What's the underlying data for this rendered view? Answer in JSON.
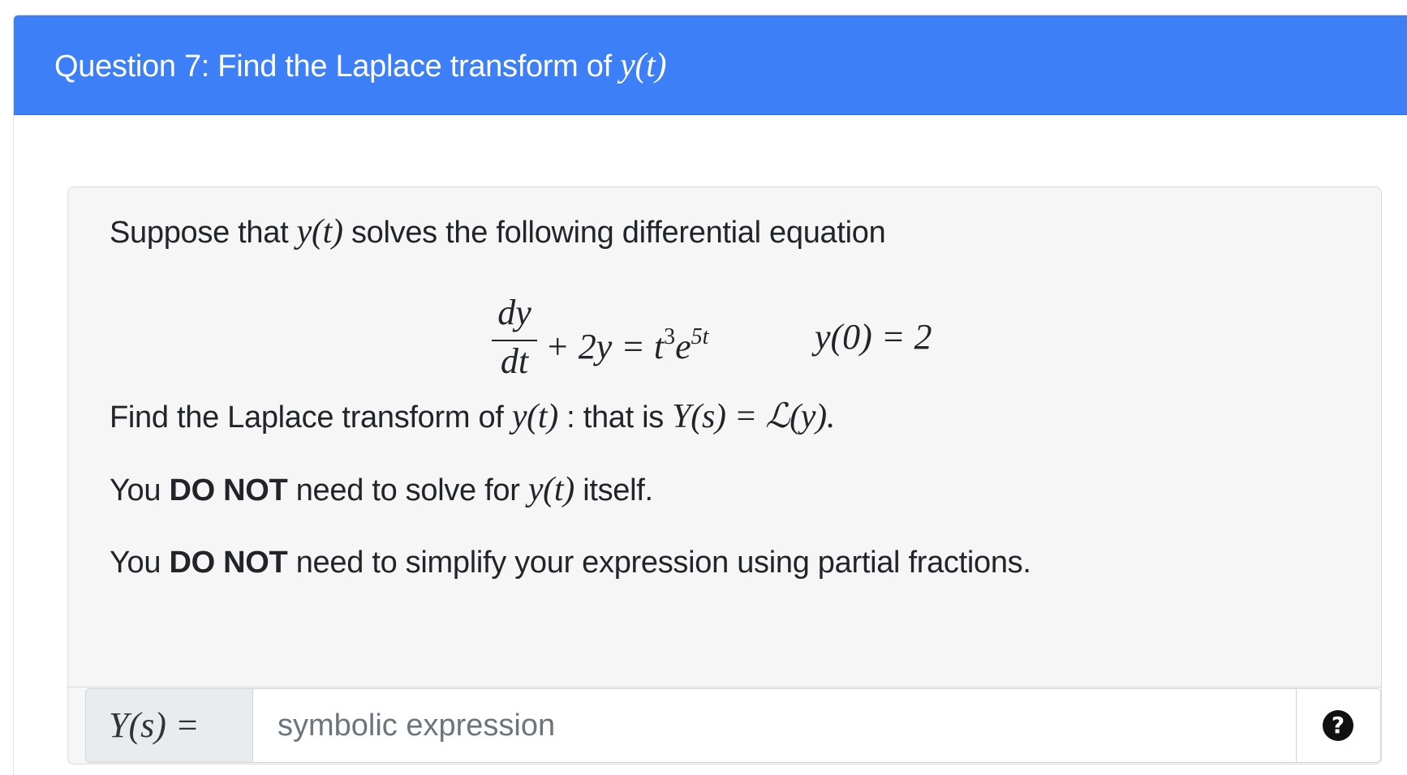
{
  "header": {
    "title_prefix": "Question 7: Find the Laplace transform of ",
    "title_math": "y(t)"
  },
  "problem": {
    "intro_prefix": "Suppose that ",
    "intro_math": "y(t)",
    "intro_suffix": " solves the following differential equation",
    "equation": {
      "numerator": "dy",
      "denominator": "dt",
      "lhs_rest": "+ 2y = t",
      "exp1": "3",
      "base2": "e",
      "exp2": "5t",
      "initial_condition": "y(0) = 2"
    },
    "find_prefix": "Find the Laplace transform of ",
    "find_math1": "y(t)",
    "find_middle": " : that is ",
    "find_math2": "Y(s) = ℒ(y).",
    "note1_prefix": "You ",
    "note1_bold": "DO NOT",
    "note1_middle": " need to solve for ",
    "note1_math": "y(t)",
    "note1_suffix": " itself.",
    "note2_prefix": "You ",
    "note2_bold": "DO NOT",
    "note2_suffix": " need to simplify your expression using partial fractions."
  },
  "answer": {
    "label": "Y(s) =",
    "placeholder": "symbolic expression",
    "value": "",
    "help_icon": "question-circle-icon",
    "help_glyph": "?"
  },
  "colors": {
    "header_bg": "#3c7ff6",
    "panel_bg": "#f6f6f6",
    "prepend_bg": "#e9ecef"
  }
}
